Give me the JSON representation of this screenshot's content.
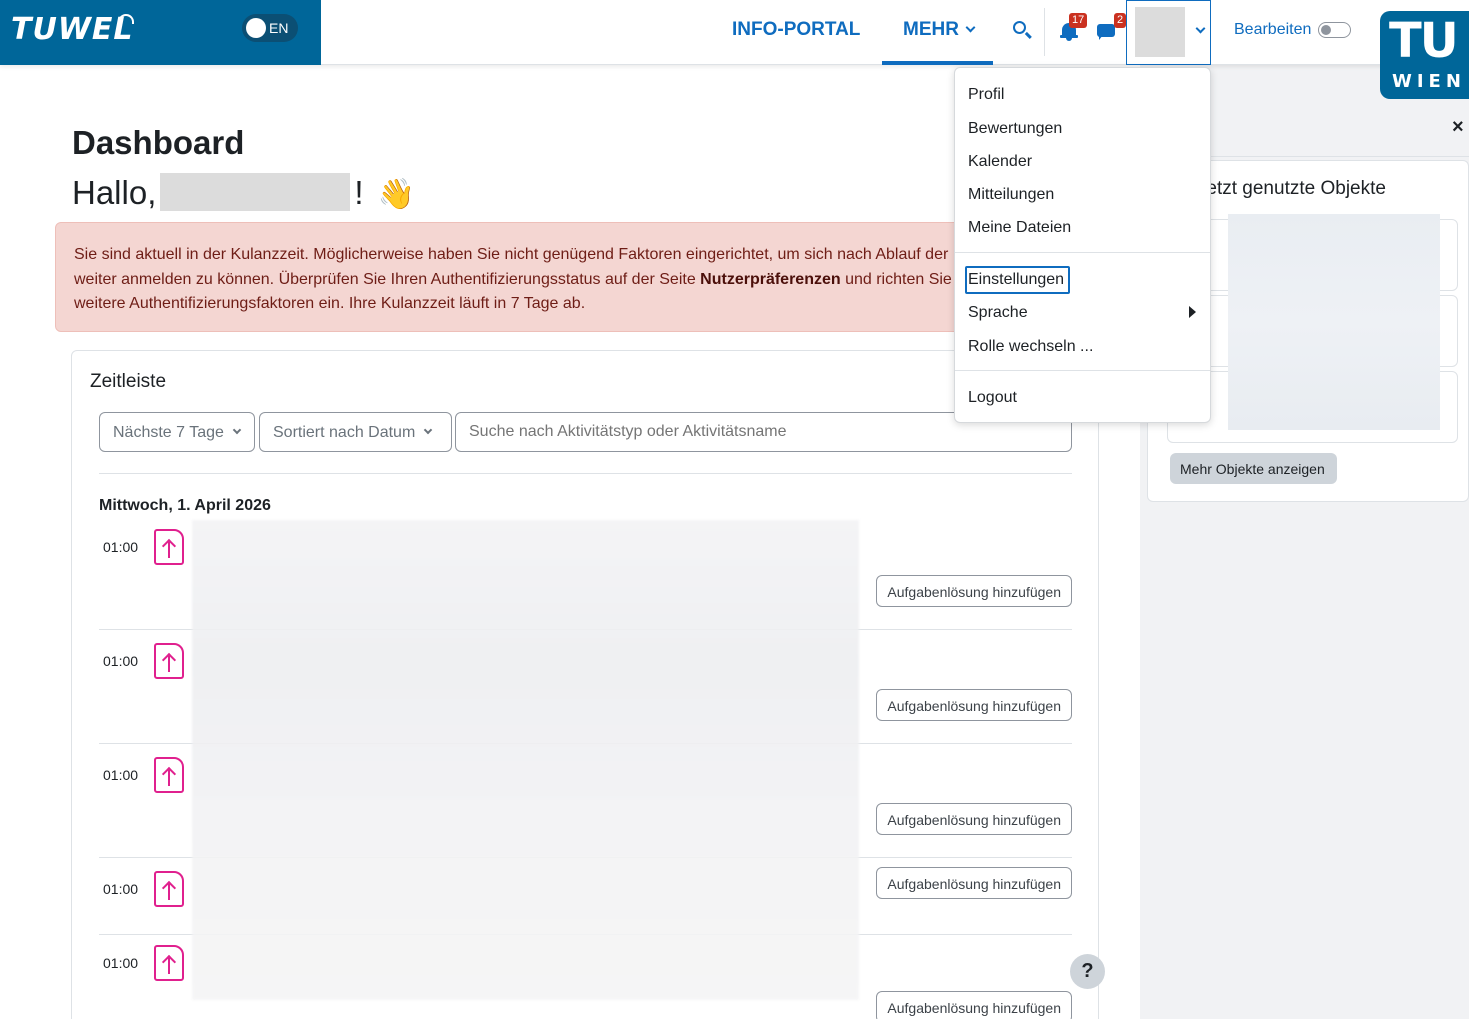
{
  "navbar": {
    "logo": "TUWEL",
    "lang_label": "EN",
    "links": {
      "info": "INFO-PORTAL",
      "mehr": "MEHR"
    },
    "notifications_count": "17",
    "messages_count": "2",
    "edit_label": "Bearbeiten",
    "tu_logo_top": "TU",
    "tu_logo_bottom": "WIEN"
  },
  "main": {
    "title": "Dashboard",
    "greeting_prefix": "Hallo,",
    "greeting_suffix": "!",
    "wave_emoji": "👋",
    "alert": {
      "text_1": "Sie sind aktuell in der Kulanzzeit. Möglicherweise haben Sie nicht genügend Faktoren eingerichtet, um sich nach Ablauf der Kulanzzeit weiter anmelden zu können. Überprüfen Sie Ihren Authentifizierungsstatus auf der Seite ",
      "link": "Nutzerpräferenzen",
      "text_2": " und richten Sie ggf. weitere Authentifizierungsfaktoren ein. Ihre Kulanzzeit läuft in 7 Tage ab."
    }
  },
  "timeline": {
    "title": "Zeitleiste",
    "filter_days": "Nächste 7 Tage",
    "sort": "Sortiert nach Datum",
    "search_placeholder": "Suche nach Aktivitätstyp oder Aktivitätsname",
    "date_heading": "Mittwoch, 1. April 2026",
    "events": [
      {
        "time": "01:00",
        "action": "Aufgabenlösung hinzufügen"
      },
      {
        "time": "01:00",
        "action": "Aufgabenlösung hinzufügen"
      },
      {
        "time": "01:00",
        "action": "Aufgabenlösung hinzufügen"
      },
      {
        "time": "01:00",
        "action": "Aufgabenlösung hinzufügen"
      },
      {
        "time": "01:00",
        "action": "Aufgabenlösung hinzufügen"
      }
    ]
  },
  "drawer": {
    "recent_title": "Zuletzt genutzte Objekte",
    "more_button": "Mehr Objekte anzeigen"
  },
  "help_label": "?",
  "close_label": "×",
  "user_menu": {
    "items": [
      {
        "label": "Profil"
      },
      {
        "label": "Bewertungen"
      },
      {
        "label": "Kalender"
      },
      {
        "label": "Mitteilungen"
      },
      {
        "label": "Meine Dateien"
      },
      {
        "label": "Einstellungen"
      },
      {
        "label": "Sprache"
      },
      {
        "label": "Rolle wechseln ..."
      },
      {
        "label": "Logout"
      }
    ]
  },
  "colors": {
    "brand": "#006699",
    "link": "#0f6cbf",
    "alert_bg": "#f4d6d2",
    "badge": "#ca3120",
    "activity_icon": "#e0208e"
  },
  "icons": [
    "search-icon",
    "bell-icon",
    "chat-icon",
    "chevron-down-icon",
    "upload-file-icon",
    "close-icon",
    "help-icon",
    "submenu-arrow-icon"
  ]
}
